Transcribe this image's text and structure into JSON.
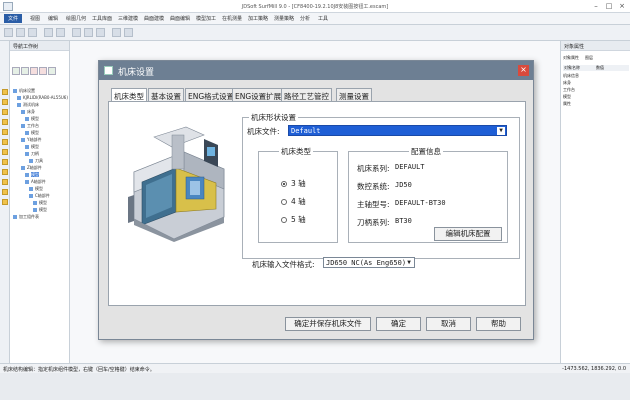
{
  "app": {
    "title": "JDSoft SurfMill 9.0 - [CF8400-19.2.10J8安装图按钮工.escam]",
    "window_controls": [
      "–",
      "□",
      "×"
    ]
  },
  "menubar": {
    "items": [
      "文件",
      "视图",
      "编辑",
      "绘图几何",
      "工具库面",
      "三维建模",
      "曲面建模",
      "曲面编辑",
      "模型加工",
      "在机测量",
      "加工策略",
      "测量策略",
      "分析",
      "工具"
    ]
  },
  "left_panel": {
    "title": "导航工作树",
    "tree": [
      {
        "label": "机床设置",
        "indent": 0,
        "selected": false
      },
      {
        "label": "KJRLIDI(RAB0-AL55U6)",
        "indent": 1,
        "selected": false
      },
      {
        "label": "测试机床",
        "indent": 1,
        "selected": false
      },
      {
        "label": "床身",
        "indent": 2,
        "selected": false
      },
      {
        "label": "模型",
        "indent": 3,
        "selected": false
      },
      {
        "label": "工作台",
        "indent": 2,
        "selected": false
      },
      {
        "label": "模型",
        "indent": 3,
        "selected": false
      },
      {
        "label": "Y轴部件",
        "indent": 2,
        "selected": false
      },
      {
        "label": "模型",
        "indent": 3,
        "selected": false
      },
      {
        "label": "刀柄",
        "indent": 3,
        "selected": false
      },
      {
        "label": "刀具",
        "indent": 4,
        "selected": false
      },
      {
        "label": "Z轴部件",
        "indent": 2,
        "selected": false
      },
      {
        "label": "模型",
        "indent": 3,
        "selected": true
      },
      {
        "label": "A轴部件",
        "indent": 3,
        "selected": false
      },
      {
        "label": "模型",
        "indent": 4,
        "selected": false
      },
      {
        "label": "C轴部件",
        "indent": 4,
        "selected": false
      },
      {
        "label": "模型",
        "indent": 5,
        "selected": false
      },
      {
        "label": "模型",
        "indent": 5,
        "selected": false
      },
      {
        "label": "加工组件表",
        "indent": 0,
        "selected": false
      }
    ]
  },
  "right_panel": {
    "title": "对象属性",
    "tabs": [
      "对象属性",
      "图层"
    ],
    "columns": [
      "对象名称",
      "数值"
    ],
    "rows": [
      "机床信息",
      "床身",
      "工作台",
      "模型",
      "属性"
    ]
  },
  "statusbar": {
    "left": "机床结构编辑：指定机床组件模型，右键（回车/空格键）结束命令。",
    "right": "-1473.562, 1836.292, 0.0"
  },
  "dialog": {
    "title": "机床设置",
    "close": "×",
    "tabs": [
      "机床类型",
      "基本设置",
      "ENG格式设置",
      "ENG设置扩展",
      "路径工艺管控",
      "测量设置"
    ],
    "active_tab": 0,
    "shape_group": {
      "legend": "机床形状设置",
      "file_label": "机床文件:",
      "file_value": "Default"
    },
    "type_group": {
      "legend": "机床类型",
      "options": [
        "3 轴",
        "4 轴",
        "5 轴"
      ],
      "selected": 0
    },
    "config_group": {
      "legend": "配置信息",
      "rows": [
        {
          "label": "机床系列:",
          "value": "DEFAULT"
        },
        {
          "label": "数控系统:",
          "value": "JD50"
        },
        {
          "label": "主轴型号:",
          "value": "DEFAULT-BT30"
        },
        {
          "label": "刀柄系列:",
          "value": "BT30"
        }
      ],
      "edit_button": "编辑机床配置"
    },
    "input_format": {
      "label": "机床输入文件格式:",
      "value": "JD650 NC(As Eng650)"
    },
    "buttons": {
      "save": "确定并保存机床文件",
      "ok": "确定",
      "cancel": "取消",
      "help": "帮助"
    }
  },
  "colors": {
    "dialog_title_bg": "#6d7f93",
    "combo_highlight": "#1f5fd6",
    "close_button": "#d94a3c",
    "active_menu": "#2a5da6"
  }
}
